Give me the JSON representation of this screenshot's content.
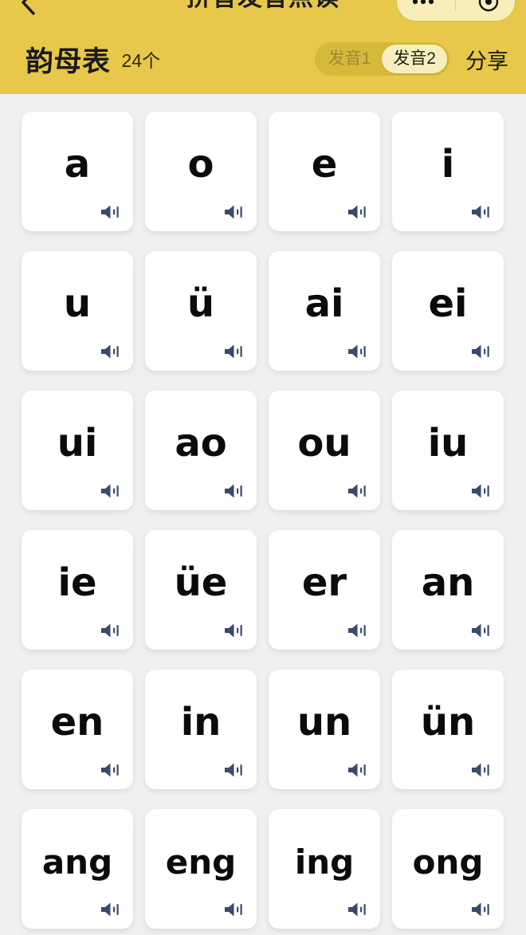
{
  "navbar": {
    "back_icon": "chevron-left-icon",
    "title": "拼音发音点读",
    "capsule": {
      "more_icon": "more-dots-icon",
      "target_icon": "target-circle-icon"
    }
  },
  "header": {
    "title": "韵母表",
    "count": "24个",
    "pronunciation_toggle": {
      "options": [
        "发音1",
        "发音2"
      ],
      "selected": "发音2"
    },
    "share_label": "分享",
    "background_color": "#e8c84a",
    "toggle_track_color": "#d6b83b",
    "toggle_active_color": "#f8efbf"
  },
  "theme": {
    "page_background": "#f0f0f0",
    "card_background": "#ffffff",
    "letter_color": "#0b0b0b",
    "speaker_icon_color": "#3a4a6b"
  },
  "grid": {
    "columns": 4,
    "speaker_icon": "speaker-sound-icon",
    "cards": [
      {
        "label": "a"
      },
      {
        "label": "o"
      },
      {
        "label": "e"
      },
      {
        "label": "i"
      },
      {
        "label": "u"
      },
      {
        "label": "ü"
      },
      {
        "label": "ai"
      },
      {
        "label": "ei"
      },
      {
        "label": "ui"
      },
      {
        "label": "ao"
      },
      {
        "label": "ou"
      },
      {
        "label": "iu"
      },
      {
        "label": "ie"
      },
      {
        "label": "üe"
      },
      {
        "label": "er"
      },
      {
        "label": "an"
      },
      {
        "label": "en"
      },
      {
        "label": "in"
      },
      {
        "label": "un"
      },
      {
        "label": "ün"
      },
      {
        "label": "ang"
      },
      {
        "label": "eng"
      },
      {
        "label": "ing"
      },
      {
        "label": "ong"
      }
    ]
  }
}
